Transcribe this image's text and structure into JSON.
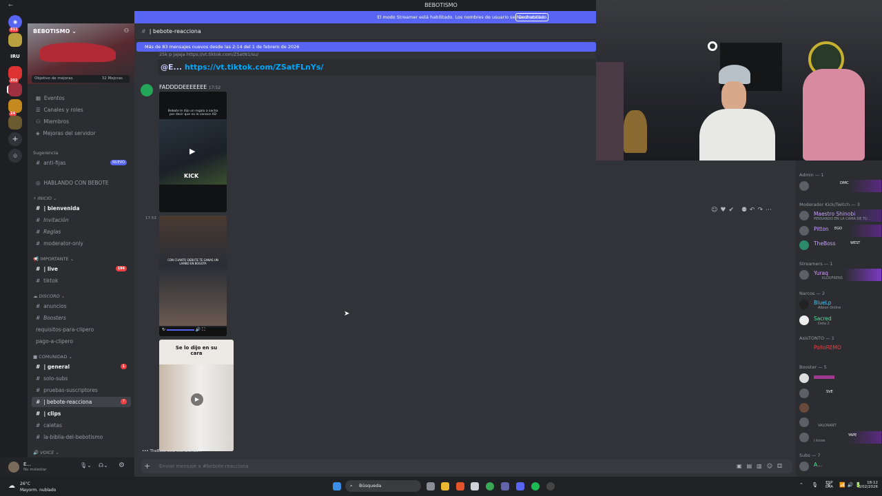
{
  "window": {
    "title": "BEBOTISMO"
  },
  "streamer_banner": {
    "text": "El modo Streamer está habilitado. Los nombres de usuario se han truncado.",
    "button": "Deshabilitar"
  },
  "servers": [
    {
      "label": "811",
      "badge": "811"
    },
    {
      "label": "IRU",
      "badge": ""
    },
    {
      "label": "",
      "badge": "202"
    },
    {
      "label": "",
      "badge": ""
    },
    {
      "label": "",
      "badge": "24"
    },
    {
      "label": "",
      "badge": ""
    }
  ],
  "sidebar": {
    "server_name": "BEBOTISMO",
    "boost_goal": "Objetivo de mejoras",
    "boost_count": "32 Mejoras",
    "top_items": [
      "Eventos",
      "Canales y roles",
      "Miembros",
      "Mejoras del servidor"
    ],
    "suggestion_title": "Sugerencia",
    "suggestion": {
      "name": "anti-fijas",
      "badge": "NUEVO"
    },
    "voice_hub": "HABLANDO CON BEBOTE",
    "categories": [
      {
        "name": "INICIO",
        "channels": [
          {
            "name": "| bienvenida",
            "bold": true,
            "badge": ""
          },
          {
            "name": "Invitación",
            "bold": false,
            "badge": ""
          },
          {
            "name": "Reglas",
            "bold": false,
            "badge": ""
          },
          {
            "name": "moderator-only",
            "bold": false,
            "badge": ""
          }
        ]
      },
      {
        "name": "IMPORTANTE",
        "channels": [
          {
            "name": "| live",
            "bold": true,
            "badge": "194"
          },
          {
            "name": "tiktok",
            "bold": false,
            "badge": ""
          }
        ]
      },
      {
        "name": "DISCORD",
        "channels": [
          {
            "name": "anuncios",
            "bold": false,
            "badge": ""
          },
          {
            "name": "Boosters",
            "bold": false,
            "badge": ""
          },
          {
            "name": "requisitos-para-clipero",
            "bold": false,
            "badge": ""
          },
          {
            "name": "pago-a-clipero",
            "bold": false,
            "badge": ""
          }
        ]
      },
      {
        "name": "COMUNIDAD",
        "channels": [
          {
            "name": "| general",
            "bold": true,
            "badge": "1"
          },
          {
            "name": "solo-subs",
            "bold": false,
            "badge": ""
          },
          {
            "name": "pruebas-suscriptores",
            "bold": false,
            "badge": ""
          },
          {
            "name": "| bebote-reacciona",
            "bold": false,
            "badge": "7",
            "active": true
          },
          {
            "name": "| clips",
            "bold": true,
            "badge": ""
          },
          {
            "name": "caletas",
            "bold": false,
            "badge": ""
          },
          {
            "name": "la-biblia-del-bebotismo",
            "bold": false,
            "badge": ""
          }
        ]
      },
      {
        "name": "VOICE",
        "channels": []
      }
    ]
  },
  "channel": {
    "name": "| bebote-reacciona"
  },
  "chat": {
    "new_messages": "Más de 83 mensajes nuevos desde las 2:14 del 1 de febrero de 2026",
    "prev_snippet": "25k p jajaja https://vt.tiktok.com/ZSatN1/su/",
    "embed_prefix": "@E...",
    "embed_link": "https://vt.tiktok.com/ZSatFLnYs/",
    "author": "FADDDDEEEEEEE",
    "time": "17:52",
    "time2": "17:53",
    "video1_caption": "Bebote le dijo un regalo a sacha por decir que no lo conoce XD",
    "video1_brand": "KICK",
    "video2_caption": "CON CUANTO DEBUTE TE GANAS UN LAMBO EN BOGOTA",
    "video3_caption": "Se lo dijo en su cara",
    "typing": "TheBoss está escribiendo..."
  },
  "composer": {
    "placeholder": "Enviar mensaje a #bebote-reacciona"
  },
  "user_panel": {
    "name": "E...",
    "status": "No molestar"
  },
  "members": {
    "groups": [
      {
        "title": "Admin — 1",
        "members": [
          {
            "name": "",
            "sub": "",
            "tag": "DMC"
          }
        ]
      },
      {
        "title": "Moderador Kick/Twitch — 3",
        "members": [
          {
            "name": "Maestro Shinobi",
            "sub": "PENSANDO EN LA CAMA DE TU ...",
            "tag": "BBG"
          },
          {
            "name": "Pitton",
            "sub": "",
            "tag": "EGO"
          },
          {
            "name": "TheBoss",
            "sub": "",
            "tag": "WEST"
          }
        ]
      },
      {
        "title": "Streamers — 1",
        "members": [
          {
            "name": "Yuraq",
            "sub": "KLOUFRENS",
            "tag": "FA"
          }
        ]
      },
      {
        "title": "Narcos — 2",
        "members": [
          {
            "name": "BlueLp",
            "sub": "Albion Online",
            "tag": ""
          },
          {
            "name": "Sacred",
            "sub": "Dota 2",
            "tag": ""
          }
        ]
      },
      {
        "title": "AsisTONTO — 1",
        "members": [
          {
            "name": "PolloREMO",
            "sub": "",
            "tag": ""
          }
        ]
      },
      {
        "title": "Booster — 5",
        "members": [
          {
            "name": "",
            "sub": "",
            "tag": ""
          },
          {
            "name": "",
            "sub": "",
            "tag": "SVE"
          },
          {
            "name": "",
            "sub": "",
            "tag": ""
          },
          {
            "name": "",
            "sub": "VALORANT",
            "tag": ""
          },
          {
            "name": "",
            "sub": "I know",
            "tag": "YAPE"
          }
        ]
      },
      {
        "title": "Subs — 7",
        "members": [
          {
            "name": "A...",
            "sub": "",
            "tag": ""
          }
        ]
      }
    ]
  },
  "taskbar": {
    "weather_temp": "26°C",
    "weather_desc": "Mayorm. nublado",
    "search": "Búsqueda",
    "lang": "ESP",
    "lang2": "LAA",
    "time": "18:12",
    "date": "3/02/2026"
  }
}
